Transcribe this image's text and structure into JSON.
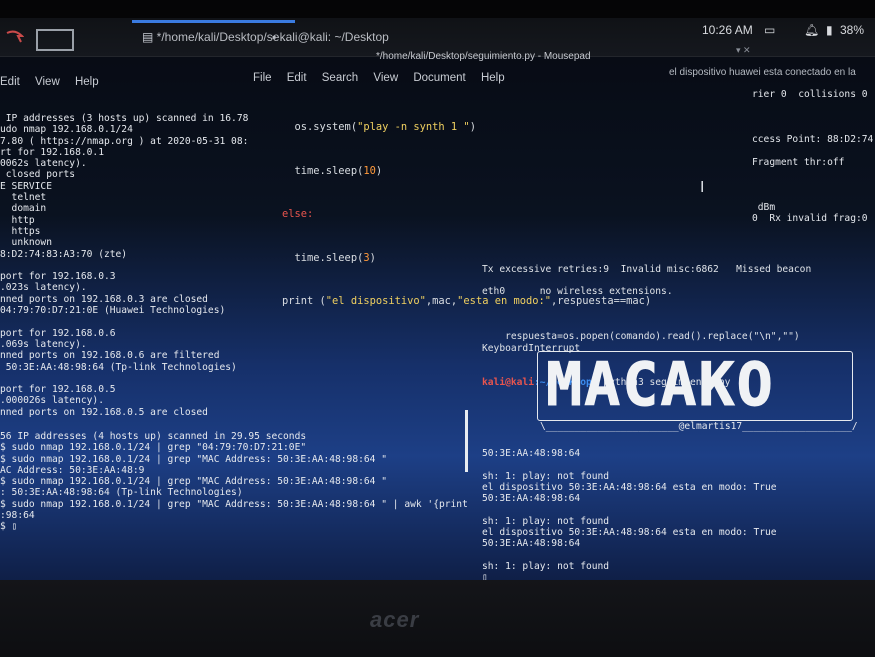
{
  "taskbar": {
    "task1": "*/home/kali/Desktop/se...",
    "task2": "kali@kali: ~/Desktop",
    "clock": "10:26 AM",
    "battery": "38%"
  },
  "left_terminal": {
    "menu": [
      "Edit",
      "View",
      "Help"
    ],
    "lines": [
      " IP addresses (3 hosts up) scanned in 16.78",
      "udo nmap 192.168.0.1/24",
      "7.80 ( https://nmap.org ) at 2020-05-31 08:",
      "rt for 192.168.0.1",
      "0062s latency).",
      " closed ports",
      "E SERVICE",
      "  telnet",
      "  domain",
      "  http",
      "  https",
      "  unknown",
      "8:D2:74:83:A3:70 (zte)",
      "",
      "port for 192.168.0.3",
      ".023s latency).",
      "nned ports on 192.168.0.3 are closed",
      "04:79:70:D7:21:0E (Huawei Technologies)",
      "",
      "port for 192.168.0.6",
      ".069s latency).",
      "nned ports on 192.168.0.6 are filtered",
      " 50:3E:AA:48:98:64 (Tp-link Technologies)",
      "",
      "port for 192.168.0.5",
      ".000026s latency).",
      "nned ports on 192.168.0.5 are closed"
    ],
    "bottom_lines": [
      "56 IP addresses (4 hosts up) scanned in 29.95 seconds",
      "$ sudo nmap 192.168.0.1/24 | grep \"04:79:70:D7:21:0E\"",
      "$ sudo nmap 192.168.0.1/24 | grep \"MAC Address: 50:3E:AA:48:98:64 \"",
      "AC Address: 50:3E:AA:48:9",
      "$ sudo nmap 192.168.0.1/24 | grep \"MAC Address: 50:3E:AA:48:98:64 \"",
      ": 50:3E:AA:48:98:64 (Tp-link Technologies)",
      "$ sudo nmap 192.168.0.1/24 | grep \"MAC Address: 50:3E:AA:48:98:64 \" | awk '{print",
      ":98:64",
      "$ ▯"
    ]
  },
  "editor": {
    "title": "*/home/kali/Desktop/seguimiento.py - Mousepad",
    "menu": [
      "File",
      "Edit",
      "Search",
      "View",
      "Document",
      "Help"
    ],
    "code": {
      "line1_a": "os.system(",
      "line1_s": "\"play -n synth 1 \"",
      "line1_b": ")",
      "line2_a": "time.sleep(",
      "line2_n": "10",
      "line2_b": ")",
      "line3_kw": "else:",
      "line4_a": "time.sleep(",
      "line4_n": "3",
      "line4_b": ")",
      "line5_a": "print (",
      "line5_s1": "\"el dispositivo\"",
      "line5_b": ",mac,",
      "line5_s2": "\"esta en modo:\"",
      "line5_c": ",respuesta==mac)"
    }
  },
  "notification": "el dispositivo huawei esta conectado en la",
  "wifi_pane": {
    "lines": [
      "rier 0  collisions 0",
      "",
      "",
      "",
      "ccess Point: 88:D2:74",
      "",
      "Fragment thr:off",
      "",
      "",
      "",
      " dBm",
      "0  Rx invalid frag:0"
    ]
  },
  "right_terminal": {
    "top_lines": [
      "Tx excessive retries:9  Invalid misc:6862   Missed beacon",
      "",
      "eth0      no wireless extensions.",
      "",
      "",
      "",
      "    respuesta=os.popen(comando).read().replace(\"\\n\",\"\")",
      "KeyboardInterrupt"
    ],
    "prompt_user": "kali@kali",
    "prompt_path": ":~/Desktop",
    "prompt_cmd": "$ python3 seguimiento.py",
    "banner": "MACAKO",
    "banner_credit": "\\_______________________@elmartis17___________________/",
    "bottom_lines": [
      "50:3E:AA:48:98:64",
      "",
      "sh: 1: play: not found",
      "el dispositivo 50:3E:AA:48:98:64 esta en modo: True",
      "50:3E:AA:48:98:64",
      "",
      "sh: 1: play: not found",
      "el dispositivo 50:3E:AA:48:98:64 esta en modo: True",
      "50:3E:AA:48:98:64",
      "",
      "sh: 1: play: not found",
      "▯"
    ]
  },
  "bezel": {
    "brand": "acer"
  },
  "colors": {
    "prompt_user": "#e8554e",
    "prompt_path": "#3b8cf0",
    "keyword": "#e8554e",
    "string": "#f0d060"
  }
}
